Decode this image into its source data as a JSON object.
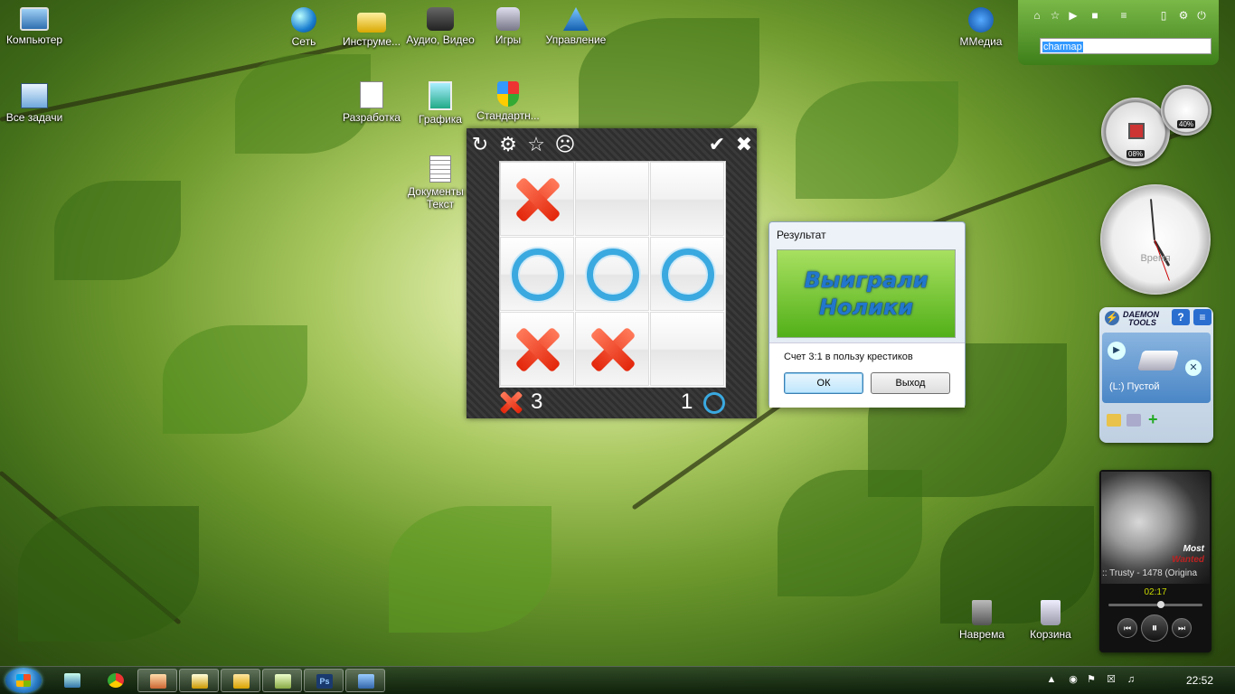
{
  "desktop": {
    "icons": [
      {
        "label": "Компьютер"
      },
      {
        "label": "Все задачи"
      },
      {
        "label": "Сеть"
      },
      {
        "label": "Инструме..."
      },
      {
        "label": "Аудио, Видео"
      },
      {
        "label": "Игры"
      },
      {
        "label": "Управление"
      },
      {
        "label": "Разработка"
      },
      {
        "label": "Графика"
      },
      {
        "label": "Стандартн..."
      },
      {
        "label": "Документы и Текст"
      },
      {
        "label": "ММедиа"
      },
      {
        "label": "Наврема"
      },
      {
        "label": "Корзина"
      }
    ]
  },
  "tictactoe": {
    "toolbar": [
      "refresh-icon",
      "settings-icon",
      "star-icon",
      "sad-face-icon",
      "minimize-icon",
      "close-icon"
    ],
    "board": [
      "x",
      "",
      "",
      "o",
      "o",
      "o",
      "x",
      "x",
      ""
    ],
    "score_x": "3",
    "score_o": "1",
    "colors": {
      "x": "#e3260b",
      "o": "#3aa9e0"
    }
  },
  "dialog": {
    "title": "Результат",
    "banner_line1": "Выиграли",
    "banner_line2": "Нолики",
    "message": "Счет 3:1 в пользу крестиков",
    "ok_label": "ОК",
    "exit_label": "Выход"
  },
  "gadgets": {
    "run_text": "charmap",
    "cpu_label": "08%",
    "mem_label": "40%",
    "clock_label": "Время",
    "daemon_brand_line1": "DAEMON",
    "daemon_brand_line2": "TOOLS",
    "daemon_drive": "(L:) Пустой",
    "player_track": ":: Trusty - 1478 (Origina",
    "player_time": "02:17",
    "player_art_text1": "Most",
    "player_art_text2": "Wanted"
  },
  "taskbar": {
    "time": "22:52",
    "items": [
      "explorer-icon",
      "chrome-icon",
      "paint-icon",
      "ie-icon",
      "folder-icon",
      "app-icon",
      "photoshop-icon",
      "network-icon"
    ]
  }
}
